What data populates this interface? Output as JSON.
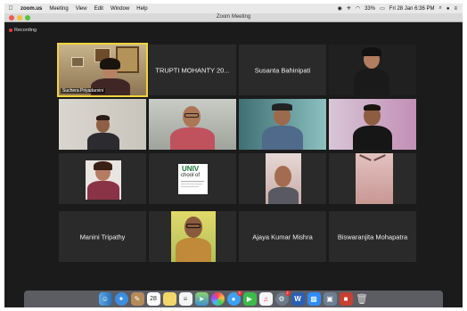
{
  "menubar": {
    "app": "zoom.us",
    "items": [
      "Meeting",
      "View",
      "Edit",
      "Window",
      "Help"
    ],
    "battery": "33%",
    "datetime": "Fri 28 Jan  6:36 PM"
  },
  "window": {
    "title": "Zoom Meeting"
  },
  "recording": "Recording",
  "participants": [
    {
      "caption": "Suchera Priyadarsini",
      "video": true
    },
    {
      "name": "TRUPTI MOHANTY 20...",
      "video": false
    },
    {
      "name": "Susanta Bahinipati",
      "video": false
    },
    {
      "video": true
    },
    {
      "video": true
    },
    {
      "video": true
    },
    {
      "video": true
    },
    {
      "video": true
    },
    {
      "video": true
    },
    {
      "logo_text": "UNIV",
      "logo_text2": "chool of",
      "video": true
    },
    {
      "video": true
    },
    {
      "video": true
    },
    {
      "name": "Manini Tripathy",
      "video": false
    },
    {
      "video": true
    },
    {
      "name": "Ajaya Kumar Mishra",
      "video": false
    },
    {
      "name": "Biswaranjita Mohapatra",
      "video": false
    }
  ],
  "dock": {
    "calendar_day": "28",
    "badges": [
      "3",
      "2"
    ],
    "word_letter": "W"
  },
  "colors": {
    "tile_bg": "#2a2a2a",
    "active_outline": "#f2d33a",
    "record_red": "#e23a3a"
  }
}
